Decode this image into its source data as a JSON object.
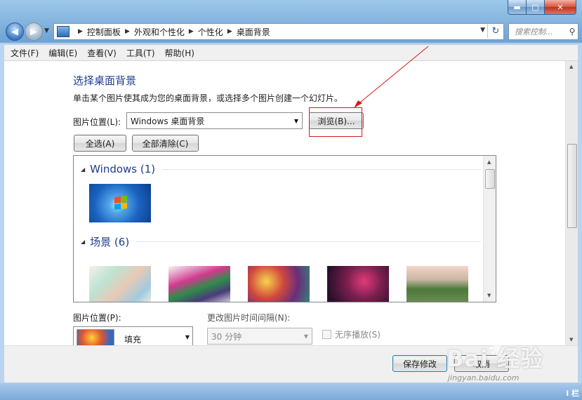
{
  "window": {
    "minimize_glyph": "▬",
    "maximize_glyph": "▢",
    "close_glyph": "✕"
  },
  "navigation": {
    "back_glyph": "◀",
    "forward_glyph": "▶",
    "breadcrumbs": [
      "控制面板",
      "外观和个性化",
      "个性化",
      "桌面背景"
    ],
    "search_placeholder": "搜索控制...",
    "refresh_glyph": "↻"
  },
  "menu": [
    "文件(F)",
    "编辑(E)",
    "查看(V)",
    "工具(T)",
    "帮助(H)"
  ],
  "page": {
    "title": "选择桌面背景",
    "description": "单击某个图片使其成为您的桌面背景，或选择多个图片创建一个幻灯片。",
    "location_label": "图片位置(L):",
    "location_value": "Windows 桌面背景",
    "browse_label": "浏览(B)...",
    "select_all_label": "全选(A)",
    "clear_all_label": "全部清除(C)"
  },
  "gallery": {
    "groups": [
      {
        "name": "Windows (1)"
      },
      {
        "name": "场景 (6)"
      }
    ]
  },
  "options": {
    "position_label": "图片位置(P):",
    "position_value": "填充",
    "interval_label": "更改图片时间间隔(N):",
    "interval_value": "30 分钟",
    "shuffle_label": "无序播放(S)"
  },
  "footer": {
    "save_label": "保存修改",
    "cancel_label": "取消"
  },
  "watermark": {
    "logo": "Bai 经验",
    "url": "jingyan.baidu.com"
  },
  "status": {
    "corner_text": "i 栏"
  },
  "colors": {
    "annotation": "#d21a1a",
    "title_blue": "#1c3f8f",
    "chrome_blue": "#6ea3d3"
  }
}
